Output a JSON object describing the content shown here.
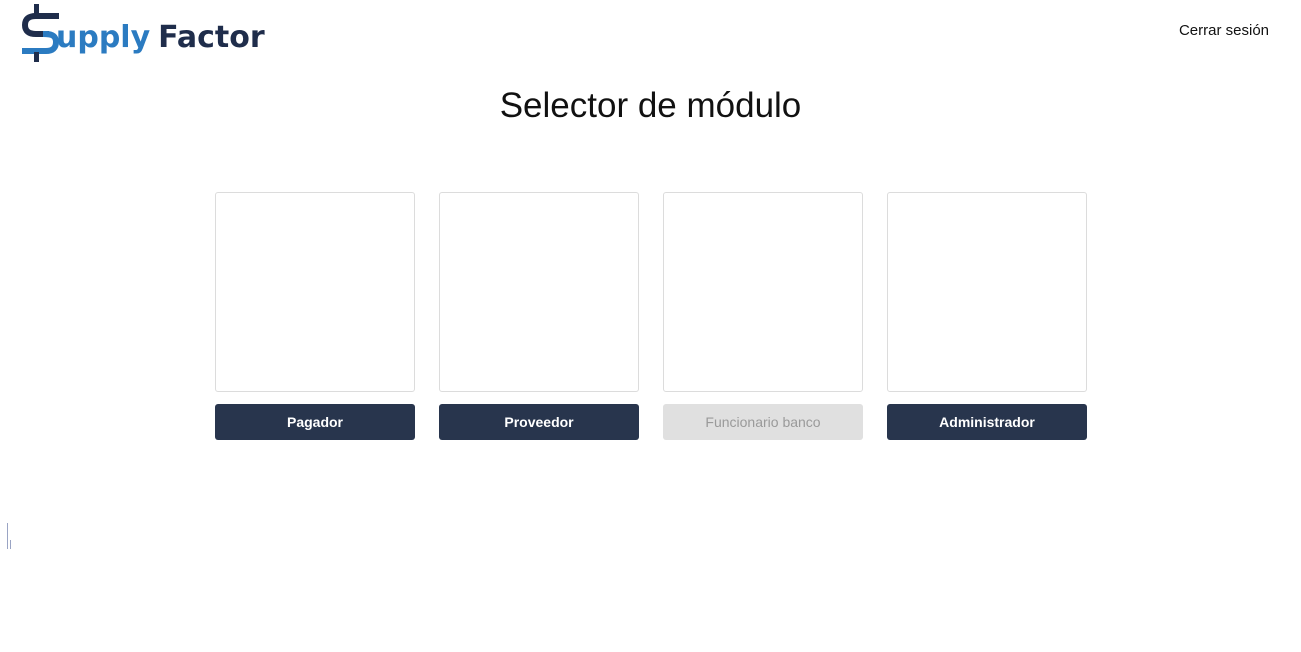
{
  "header": {
    "logo_text_part1": "upply",
    "logo_text_part2": "Factor",
    "logout_label": "Cerrar sesión"
  },
  "main": {
    "title": "Selector de módulo",
    "modules": [
      {
        "label": "Pagador",
        "enabled": true
      },
      {
        "label": "Proveedor",
        "enabled": true
      },
      {
        "label": "Funcionario banco",
        "enabled": false
      },
      {
        "label": "Administrador",
        "enabled": true
      }
    ]
  },
  "colors": {
    "brand_blue": "#2b7bc1",
    "brand_navy": "#1f2d4b",
    "button_bg": "#28354d",
    "button_disabled_bg": "#e0e0e0",
    "button_disabled_text": "#9a9a9a"
  },
  "icons": {
    "logo": "dollar-s-logo-icon"
  }
}
